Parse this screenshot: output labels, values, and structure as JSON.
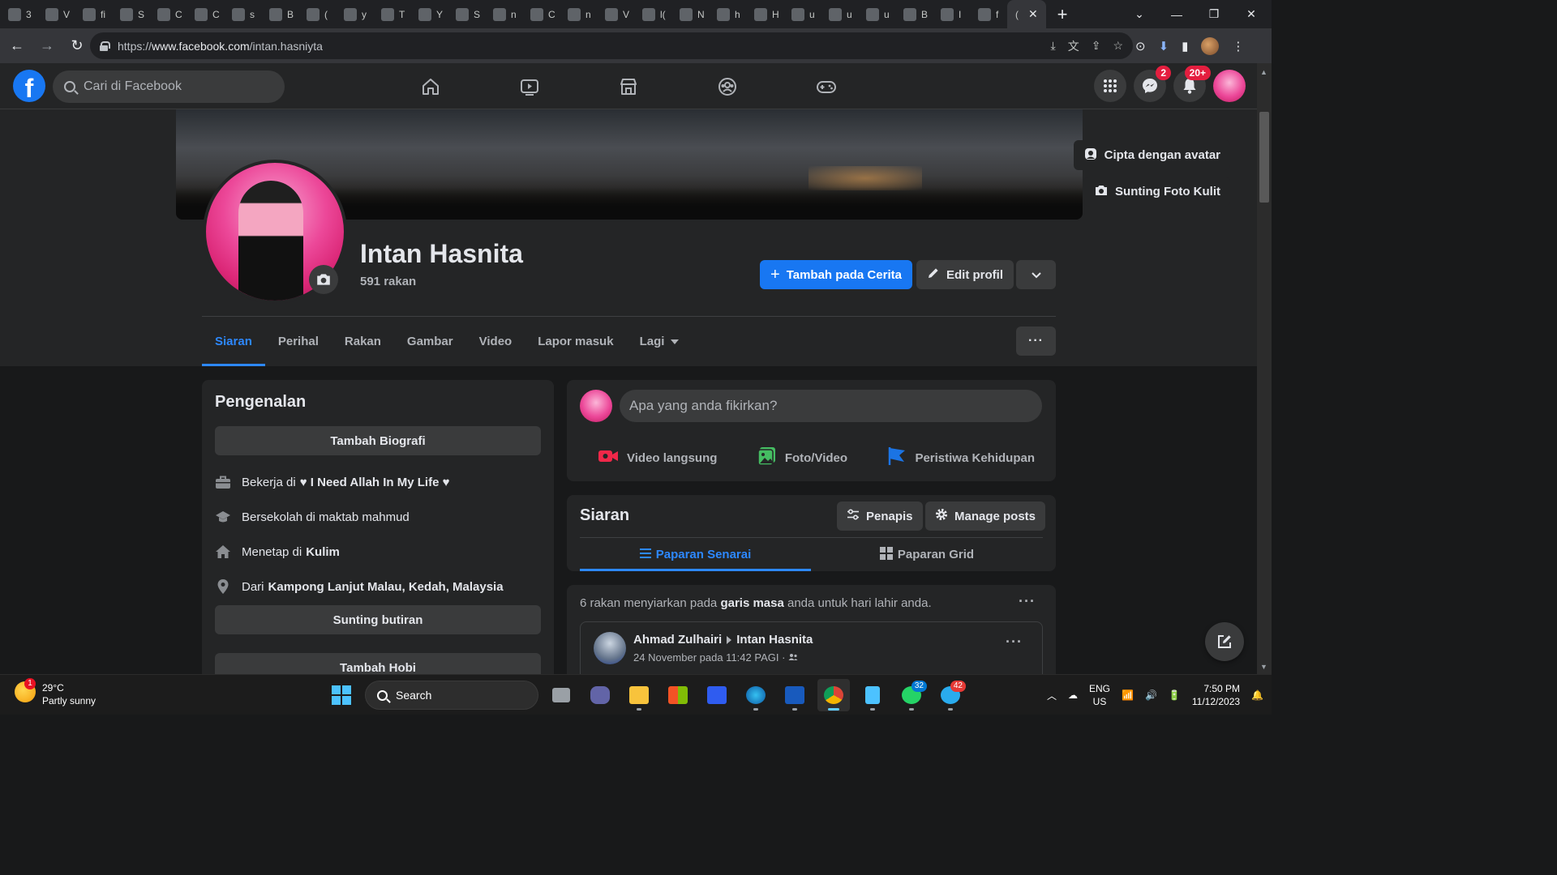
{
  "browser": {
    "tabs": [
      {
        "icon": "globe-icon",
        "label": "3"
      },
      {
        "icon": "w-icon",
        "label": "V"
      },
      {
        "icon": "yahoo-icon",
        "label": "fi"
      },
      {
        "icon": "globe-icon",
        "label": "S"
      },
      {
        "icon": "translate-icon",
        "label": "C"
      },
      {
        "icon": "yahoo-icon",
        "label": "C"
      },
      {
        "icon": "yahoo-icon",
        "label": "s"
      },
      {
        "icon": "grid-icon",
        "label": "B"
      },
      {
        "icon": "youtube-icon",
        "label": "("
      },
      {
        "icon": "yahoo-icon",
        "label": "y"
      },
      {
        "icon": "chart-icon",
        "label": "T"
      },
      {
        "icon": "download-icon",
        "label": "Y"
      },
      {
        "icon": "globe-icon",
        "label": "S"
      },
      {
        "icon": "yahoo-icon",
        "label": "n"
      },
      {
        "icon": "e-icon",
        "label": "C"
      },
      {
        "icon": "r-icon",
        "label": "n"
      },
      {
        "icon": "blogger-icon",
        "label": "V"
      },
      {
        "icon": "globe-icon",
        "label": "l("
      },
      {
        "icon": "globe-icon",
        "label": "N"
      },
      {
        "icon": "yahoo-icon",
        "label": "h"
      },
      {
        "icon": "a-icon",
        "label": "H"
      },
      {
        "icon": "yahoo-icon",
        "label": "u"
      },
      {
        "icon": "yahoo-icon",
        "label": "u"
      },
      {
        "icon": "note-icon",
        "label": "u"
      },
      {
        "icon": "grid-icon",
        "label": "B"
      },
      {
        "icon": "instagram-icon",
        "label": "I"
      },
      {
        "icon": "yahoo-icon",
        "label": "f"
      }
    ],
    "active_tab_label": "(",
    "url_host": "www.facebook.com",
    "url_prefix": "https://",
    "url_path": "/intan.hasniyta"
  },
  "fb": {
    "search_placeholder": "Cari di Facebook",
    "messenger_badge": "2",
    "notifications_badge": "20+"
  },
  "profile": {
    "name": "Intan Hasnita",
    "friends": "591 rakan",
    "cover_buttons": {
      "avatar": "Cipta dengan avatar",
      "edit_cover": "Sunting Foto Kulit"
    },
    "add_story": "Tambah pada Cerita",
    "edit_profile": "Edit profil",
    "tabs": [
      "Siaran",
      "Perihal",
      "Rakan",
      "Gambar",
      "Video",
      "Lapor masuk",
      "Lagi"
    ]
  },
  "intro": {
    "title": "Pengenalan",
    "add_bio": "Tambah Biografi",
    "items": [
      {
        "icon": "briefcase-icon",
        "prefix": "Bekerja di",
        "strong": "♥ I Need Allah In My Life ♥"
      },
      {
        "icon": "graduation-cap-icon",
        "prefix": "Bersekolah di maktab mahmud",
        "strong": ""
      },
      {
        "icon": "home-icon",
        "prefix": "Menetap di",
        "strong": "Kulim"
      },
      {
        "icon": "location-pin-icon",
        "prefix": "Dari",
        "strong": "Kampong Lanjut Malau, Kedah, Malaysia"
      }
    ],
    "edit_details": "Sunting butiran",
    "add_hobbies": "Tambah Hobi"
  },
  "composer": {
    "placeholder": "Apa yang anda fikirkan?",
    "live": "Video langsung",
    "photo": "Foto/Video",
    "life_event": "Peristiwa Kehidupan"
  },
  "posts": {
    "title": "Siaran",
    "filter": "Penapis",
    "manage": "Manage posts",
    "list_view": "Paparan Senarai",
    "grid_view": "Paparan Grid"
  },
  "birthday": {
    "msg_a": "6 rakan menyiarkan pada ",
    "msg_b": "garis masa",
    "msg_c": " anda untuk hari lahir anda.",
    "author": "Ahmad Zulhairi",
    "target": "Intan Hasnita",
    "time": "24 November pada 11:42 PAGI ·"
  },
  "taskbar": {
    "temp": "29°C",
    "condition": "Partly sunny",
    "weather_badge": "1",
    "search": "Search",
    "whatsapp_badge": "32",
    "telegram_badge": "42",
    "lang1": "ENG",
    "lang2": "US",
    "time": "7:50 PM",
    "date": "11/12/2023"
  },
  "colors": {
    "fb_blue": "#1877f2",
    "active_tab_blue": "#2d88ff",
    "background": "#18191a",
    "card": "#242526"
  }
}
